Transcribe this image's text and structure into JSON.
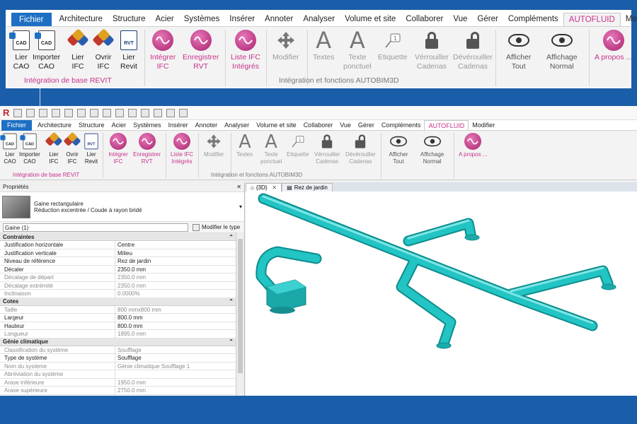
{
  "colors": {
    "brand_blue": "#1a5da8",
    "file_tab": "#1e6fc4",
    "autofluid_pink": "#c8318a",
    "duct": "#1fb6b6"
  },
  "ribbon_zoom": {
    "tabs": [
      "Fichier",
      "Architecture",
      "Structure",
      "Acier",
      "Systèmes",
      "Insérer",
      "Annoter",
      "Analyser",
      "Volume et site",
      "Collaborer",
      "Vue",
      "Gérer",
      "Compléments",
      "AUTOFLUID",
      "Modifier"
    ],
    "buttons": {
      "lier_cao": "Lier\nCAO",
      "importer_cao": "Importer\nCAO",
      "lier_ifc": "Lier\nIFC",
      "ovrir_ifc": "Ovrir\nIFC",
      "lier_revit": "Lier\nRevit",
      "integrer_ifc": "Intégrer\nIFC",
      "enregistrer_rvt": "Enregistrer\nRVT",
      "liste_ifc": "Liste IFC\nIntégrés",
      "modifier": "Modifier",
      "textes": "Textes",
      "texte_ponctuel": "Texte\nponctuel",
      "etiquette": "Etiquette",
      "verrouiller": "Vérrouiller\nCadenas",
      "deverrouiller": "Dévérouiller\nCadenas",
      "afficher_tout": "Afficher\nTout",
      "affichage_normal": "Affichage\nNormal",
      "apropos": "A propos ..."
    },
    "groups": {
      "base": "Intégration de base REVIT",
      "fonctions": "Intégration et fonctions AUTOBIM3D"
    }
  },
  "app": {
    "tabs": [
      "Fichier",
      "Architecture",
      "Structure",
      "Acier",
      "Systèmes",
      "Insérer",
      "Annoter",
      "Analyser",
      "Volume et site",
      "Collaborer",
      "Vue",
      "Gérer",
      "Compléments",
      "AUTOFLUID",
      "Modifier"
    ],
    "props": {
      "title": "Propriétés",
      "type_name": "Gaine rectangulaire",
      "type_sub": "Réduction excentrée / Coude à rayon bridé",
      "selector": "Gaine (1)",
      "edit_type": "Modifier le type",
      "sections": [
        {
          "name": "Contraintes",
          "rows": [
            {
              "k": "Justification horizontale",
              "v": "Centre",
              "ro": false
            },
            {
              "k": "Justification verticale",
              "v": "Milieu",
              "ro": false
            },
            {
              "k": "Niveau de référence",
              "v": "Rez de jardin",
              "ro": false
            },
            {
              "k": "Décaler",
              "v": "2350.0 mm",
              "ro": false
            },
            {
              "k": "Décalage de départ",
              "v": "2350.0 mm",
              "ro": true
            },
            {
              "k": "Décalage extrémité",
              "v": "2350.0 mm",
              "ro": true
            },
            {
              "k": "Inclinaison",
              "v": "0.0000%",
              "ro": true
            }
          ]
        },
        {
          "name": "Cotes",
          "rows": [
            {
              "k": "Taille",
              "v": "800 mmx800 mm",
              "ro": true
            },
            {
              "k": "Largeur",
              "v": "800.0 mm",
              "ro": false
            },
            {
              "k": "Hauteur",
              "v": "800.0 mm",
              "ro": false
            },
            {
              "k": "Longueur",
              "v": "1895.0 mm",
              "ro": true
            }
          ]
        },
        {
          "name": "Génie climatique",
          "rows": [
            {
              "k": "Classification du système",
              "v": "Soufflage",
              "ro": true
            },
            {
              "k": "Type de système",
              "v": "Soufflage",
              "ro": false
            },
            {
              "k": "Nom du système",
              "v": "Génie climatique Soufflage 1",
              "ro": true
            },
            {
              "k": "Abréviation du système",
              "v": "",
              "ro": true
            },
            {
              "k": "Arase inférieure",
              "v": "1950.0 mm",
              "ro": true
            },
            {
              "k": "Arase supérieure",
              "v": "2750.0 mm",
              "ro": true
            }
          ]
        }
      ]
    },
    "view_tabs": {
      "t3d": "{3D}",
      "plan": "Rez de jardin"
    }
  }
}
